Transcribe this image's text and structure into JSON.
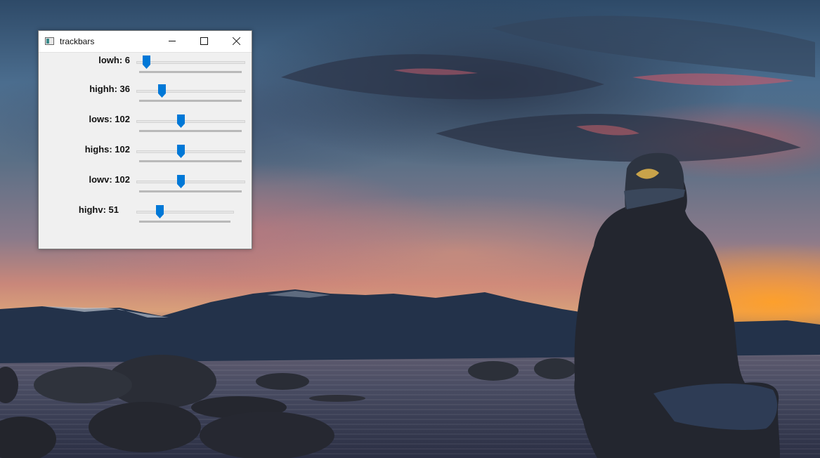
{
  "window": {
    "title": "trackbars",
    "controls": {
      "minimize": "minimize-icon",
      "maximize": "maximize-icon",
      "close": "close-icon"
    }
  },
  "accent_color": "#0078d7",
  "trackbars": [
    {
      "label": "lowh: 6",
      "value": 6,
      "max": 179
    },
    {
      "label": "highh: 36",
      "value": 36,
      "max": 179
    },
    {
      "label": "lows: 102",
      "value": 102,
      "max": 255
    },
    {
      "label": "highs: 102",
      "value": 102,
      "max": 255
    },
    {
      "label": "lowv: 102",
      "value": 102,
      "max": 255
    },
    {
      "label": "highv: 51",
      "value": 51,
      "max": 255
    }
  ]
}
